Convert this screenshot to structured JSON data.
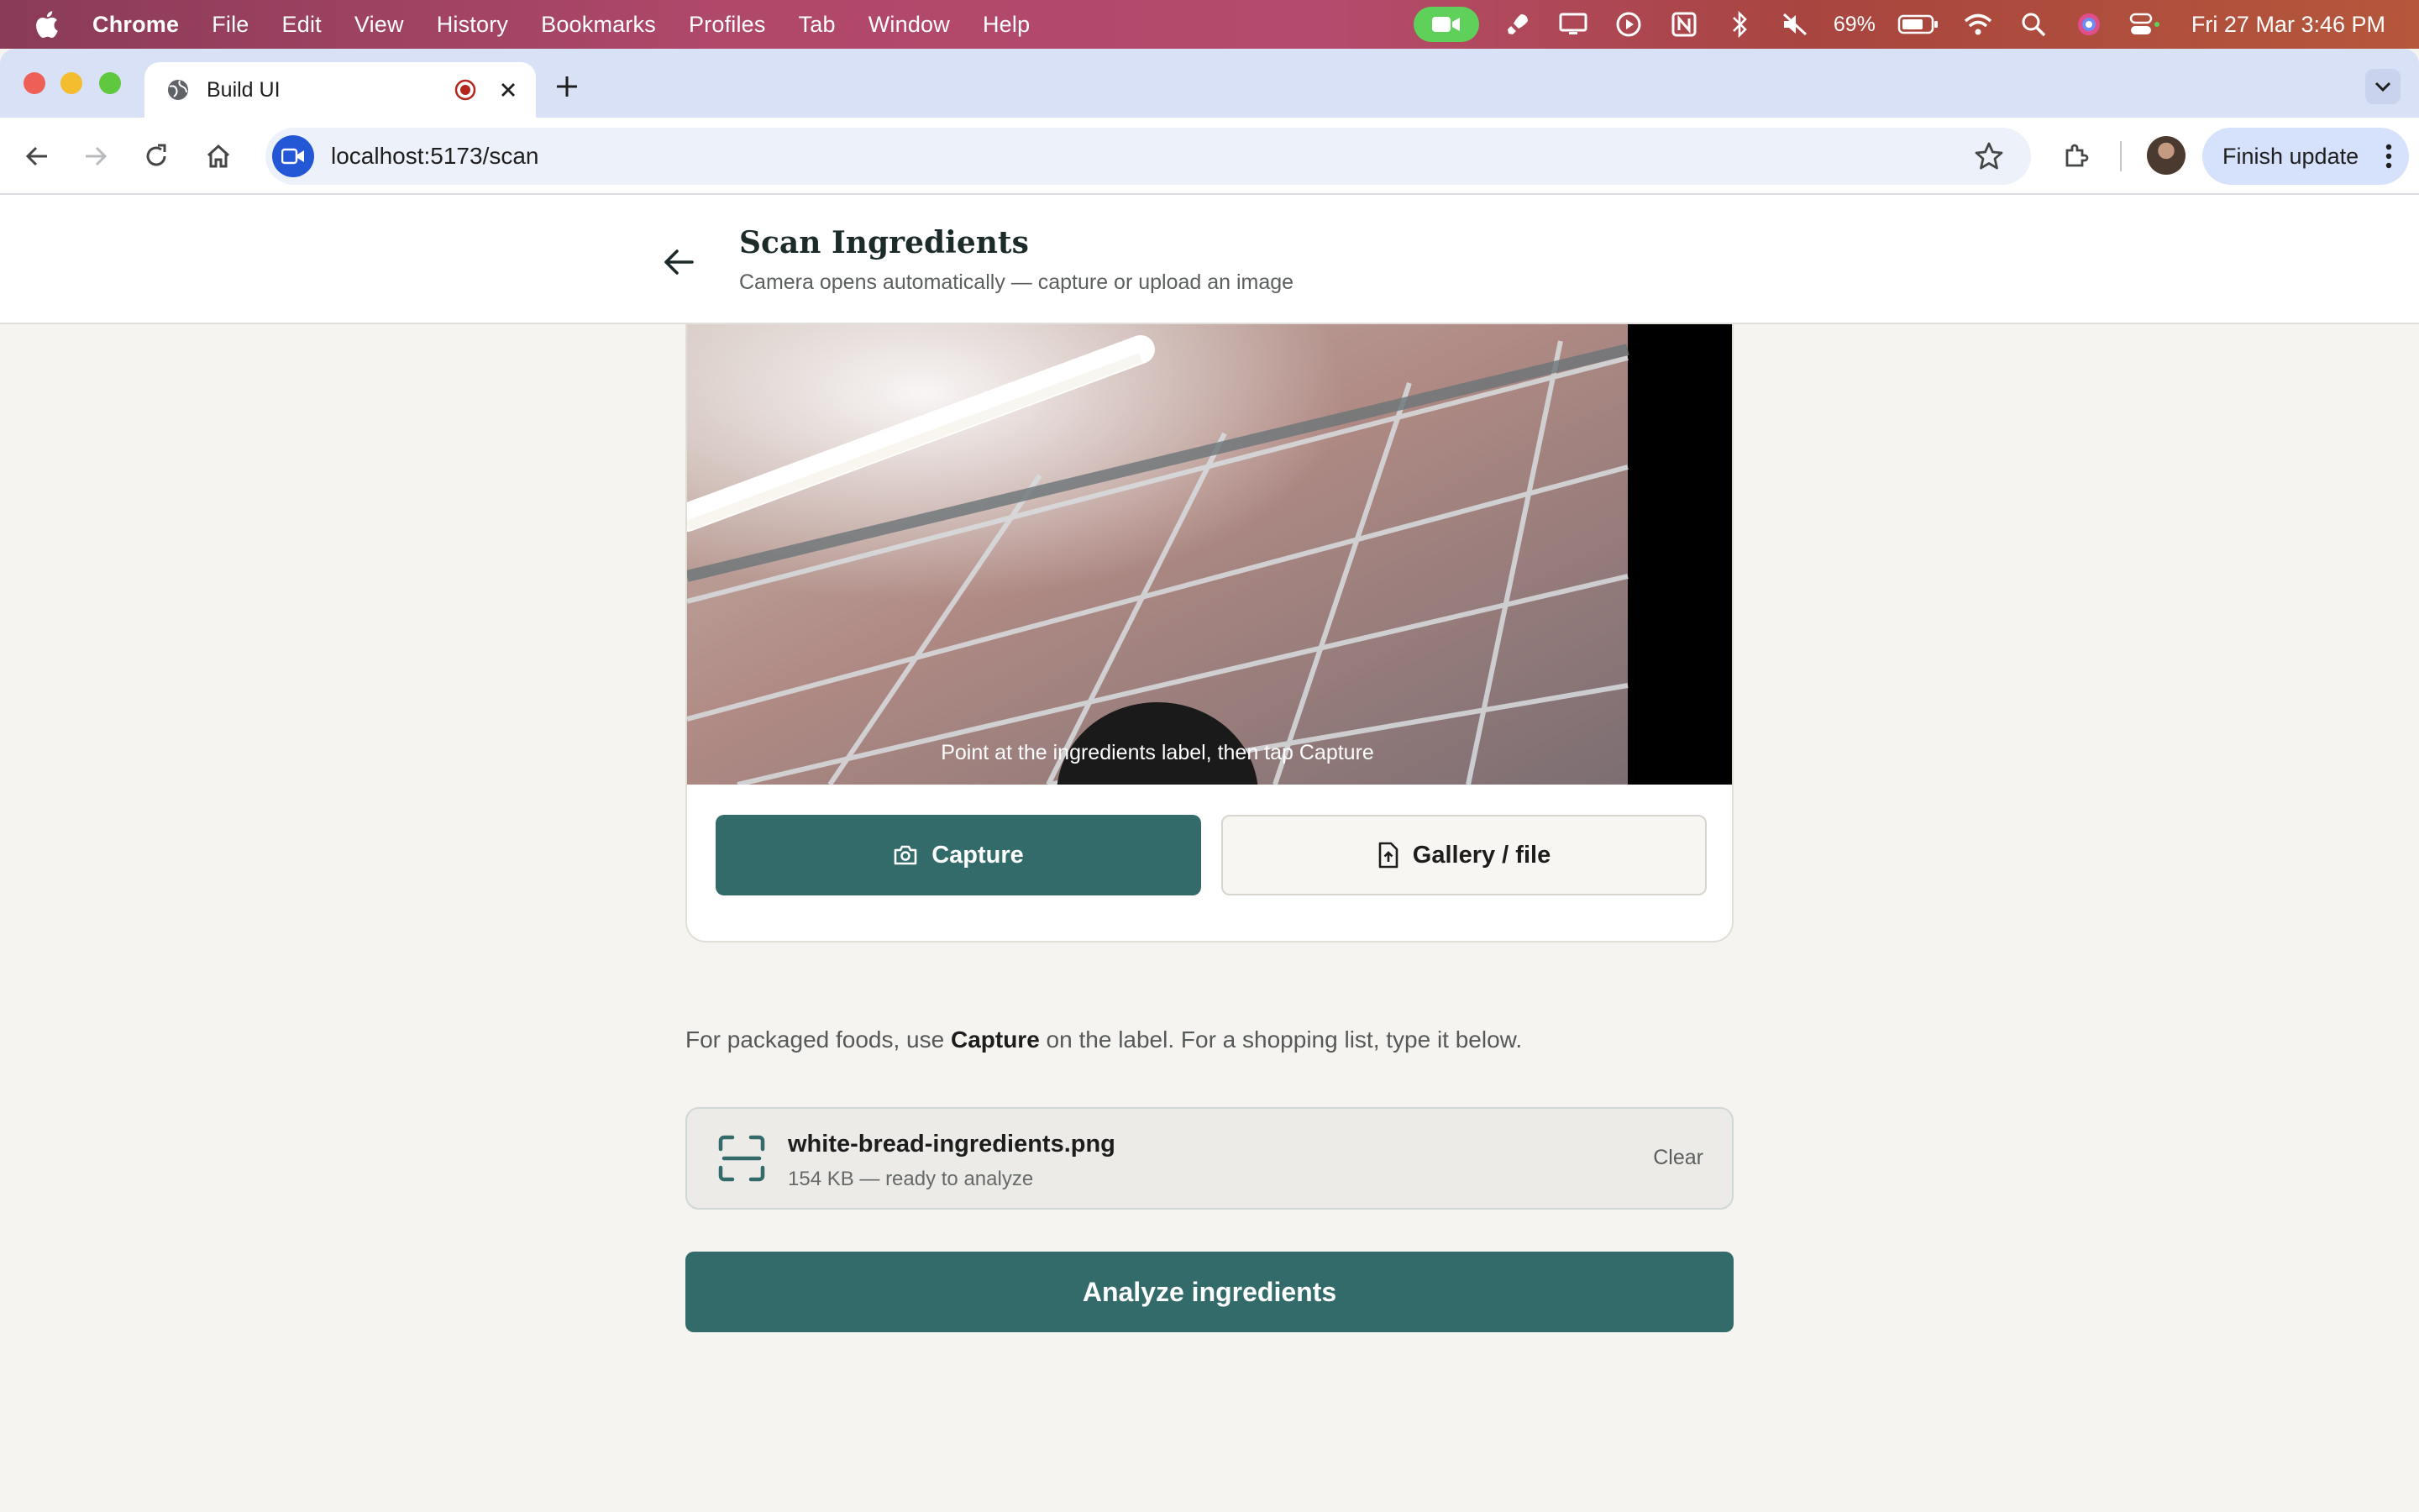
{
  "menubar": {
    "app_name": "Chrome",
    "items": [
      "File",
      "Edit",
      "View",
      "History",
      "Bookmarks",
      "Profiles",
      "Tab",
      "Window",
      "Help"
    ],
    "battery": "69%",
    "clock": "Fri 27 Mar  3:46 PM"
  },
  "browser": {
    "tab_title": "Build UI",
    "url": "localhost:5173/scan",
    "finish_update_label": "Finish update"
  },
  "page": {
    "title": "Scan Ingredients",
    "subtitle": "Camera opens automatically — capture or upload an image",
    "camera_hint": "Point at the ingredients label, then tap Capture",
    "capture_label": "Capture",
    "gallery_label": "Gallery / file",
    "note_prefix": "For packaged foods, use ",
    "note_bold": "Capture",
    "note_suffix": " on the label. For a shopping list, type it below.",
    "file": {
      "name": "white-bread-ingredients.png",
      "meta": "154 KB — ready to analyze",
      "clear_label": "Clear"
    },
    "analyze_label": "Analyze ingredients"
  },
  "colors": {
    "primary": "#336b6a",
    "background": "#f5f4f1",
    "card": "#ffffff"
  }
}
